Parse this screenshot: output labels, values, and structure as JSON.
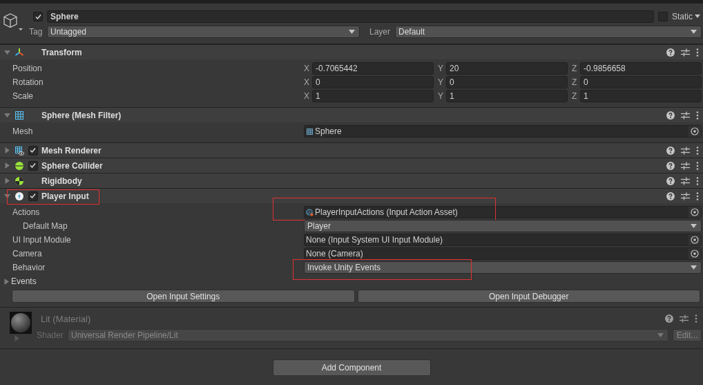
{
  "game_object": {
    "enabled": true,
    "name": "Sphere",
    "static": false,
    "static_label": "Static",
    "tag_label": "Tag",
    "tag": "Untagged",
    "layer_label": "Layer",
    "layer": "Default"
  },
  "components": [
    {
      "kind": "transform",
      "title": "Transform",
      "expanded": true,
      "rows": [
        {
          "label": "Position",
          "values": [
            {
              "axis": "X",
              "value": "-0.7065442"
            },
            {
              "axis": "Y",
              "value": "20"
            },
            {
              "axis": "Z",
              "value": "-0.9856658"
            }
          ]
        },
        {
          "label": "Rotation",
          "values": [
            {
              "axis": "X",
              "value": "0"
            },
            {
              "axis": "Y",
              "value": "0"
            },
            {
              "axis": "Z",
              "value": "0"
            }
          ]
        },
        {
          "label": "Scale",
          "values": [
            {
              "axis": "X",
              "value": "1"
            },
            {
              "axis": "Y",
              "value": "1"
            },
            {
              "axis": "Z",
              "value": "1"
            }
          ]
        }
      ]
    },
    {
      "kind": "mesh_filter",
      "title": "Sphere (Mesh Filter)",
      "expanded": true,
      "properties": [
        {
          "kind": "mesh_ref",
          "label": "Mesh",
          "value": "Sphere",
          "highlighted": false
        }
      ]
    },
    {
      "kind": "mesh_renderer",
      "title": "Mesh Renderer",
      "expanded": false,
      "enabled": true
    },
    {
      "kind": "sphere_collider",
      "title": "Sphere Collider",
      "expanded": false,
      "enabled": true
    },
    {
      "kind": "rigidbody",
      "title": "Rigidbody",
      "expanded": false
    },
    {
      "kind": "player_input",
      "title": "Player Input",
      "expanded": true,
      "enabled": true,
      "highlighted": true,
      "properties": [
        {
          "kind": "asset_ref",
          "label": "Actions",
          "value": "PlayerInputActions (Input Action Asset)",
          "highlighted": true,
          "children": [
            {
              "kind": "dropdown",
              "label": "Default Map",
              "value": "Player",
              "highlighted": false
            }
          ]
        },
        {
          "kind": "object",
          "label": "UI Input Module",
          "value": "None (Input System UI Input Module)",
          "highlighted": false
        },
        {
          "kind": "object",
          "label": "Camera",
          "value": "None (Camera)",
          "highlighted": false
        },
        {
          "kind": "dropdown",
          "label": "Behavior",
          "value": "Invoke Unity Events",
          "highlighted": true
        },
        {
          "kind": "foldout",
          "label": "Events",
          "expanded": false
        }
      ],
      "buttons": [
        "Open Input Settings",
        "Open Input Debugger"
      ]
    }
  ],
  "material": {
    "name": "Lit (Material)",
    "expanded": false,
    "shader_label": "Shader",
    "shader": "Universal Render Pipeline/Lit",
    "edit_button": "Edit..."
  },
  "add_component": "Add Component"
}
